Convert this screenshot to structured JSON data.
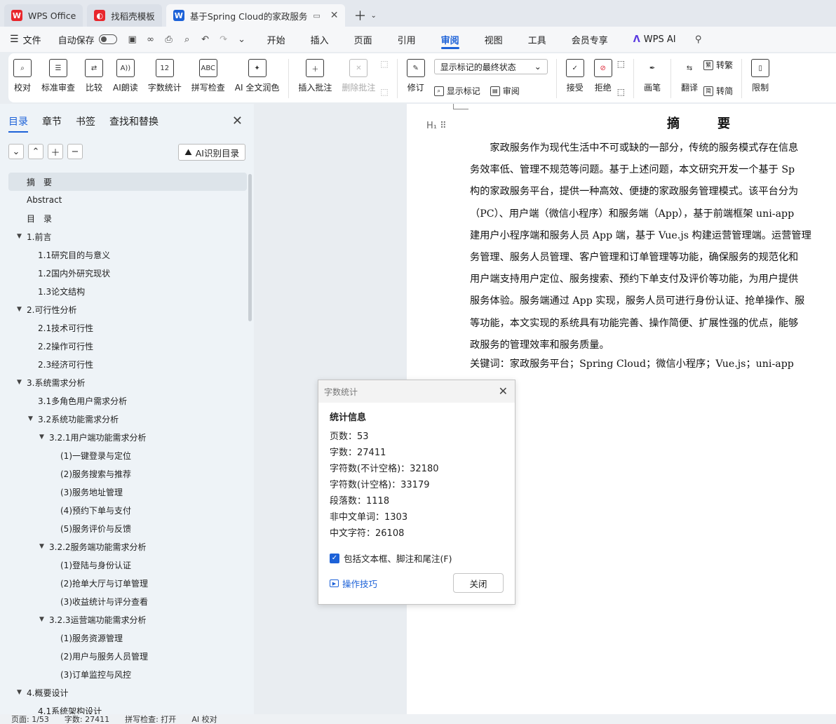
{
  "tabs": [
    {
      "label": "WPS Office",
      "logo_color": "#e8262c"
    },
    {
      "label": "找稻壳模板",
      "logo_color": "#e8262c"
    },
    {
      "label": "基于Spring Cloud的家政服务",
      "logo_color": "#1d62d8"
    }
  ],
  "menu": {
    "file": "文件",
    "autosave": "自动保存",
    "tabs": [
      "开始",
      "插入",
      "页面",
      "引用",
      "审阅",
      "视图",
      "工具",
      "会员专享"
    ],
    "active_tab": "审阅",
    "wps_ai": "WPS AI"
  },
  "ribbon": {
    "proof": "校对",
    "std_review": "标准审查",
    "compare": "比较",
    "ai_read": "AI朗读",
    "word_count": "字数统计",
    "spell": "拼写检查",
    "ai_polish": "AI 全文润色",
    "insert_comment": "插入批注",
    "delete_comment": "删除批注",
    "revise": "修订",
    "markup_select": "显示标记的最终状态",
    "show_markup": "显示标记",
    "review": "审阅",
    "accept": "接受",
    "reject": "拒绝",
    "pen": "画笔",
    "translate": "翻译",
    "to_trad": "转繁",
    "to_simp": "转简",
    "restrict": "限制"
  },
  "nav": {
    "tabs": [
      "目录",
      "章节",
      "书签",
      "查找和替换"
    ],
    "ai_toc": "AI识别目录",
    "items": [
      {
        "label": "摘　要",
        "level": 0,
        "arrow": false,
        "selected": true
      },
      {
        "label": "Abstract",
        "level": 0,
        "arrow": false
      },
      {
        "label": "目　录",
        "level": 0,
        "arrow": false
      },
      {
        "label": "1.前言",
        "level": 0,
        "arrow": true
      },
      {
        "label": "1.1研究目的与意义",
        "level": 1,
        "arrow": false
      },
      {
        "label": "1.2国内外研究现状",
        "level": 1,
        "arrow": false
      },
      {
        "label": "1.3论文结构",
        "level": 1,
        "arrow": false
      },
      {
        "label": "2.可行性分析",
        "level": 0,
        "arrow": true
      },
      {
        "label": "2.1技术可行性",
        "level": 1,
        "arrow": false
      },
      {
        "label": "2.2操作可行性",
        "level": 1,
        "arrow": false
      },
      {
        "label": "2.3经济可行性",
        "level": 1,
        "arrow": false
      },
      {
        "label": "3.系统需求分析",
        "level": 0,
        "arrow": true
      },
      {
        "label": "3.1多角色用户需求分析",
        "level": 1,
        "arrow": false
      },
      {
        "label": "3.2系统功能需求分析",
        "level": 1,
        "arrow": true
      },
      {
        "label": "3.2.1用户端功能需求分析",
        "level": 2,
        "arrow": true
      },
      {
        "label": "(1)一键登录与定位",
        "level": 3,
        "arrow": false
      },
      {
        "label": "(2)服务搜索与推荐",
        "level": 3,
        "arrow": false
      },
      {
        "label": "(3)服务地址管理",
        "level": 3,
        "arrow": false
      },
      {
        "label": "(4)预约下单与支付",
        "level": 3,
        "arrow": false
      },
      {
        "label": "(5)服务评价与反馈",
        "level": 3,
        "arrow": false
      },
      {
        "label": "3.2.2服务端功能需求分析",
        "level": 2,
        "arrow": true
      },
      {
        "label": "(1)登陆与身份认证",
        "level": 3,
        "arrow": false
      },
      {
        "label": "(2)抢单大厅与订单管理",
        "level": 3,
        "arrow": false
      },
      {
        "label": "(3)收益统计与评分查看",
        "level": 3,
        "arrow": false
      },
      {
        "label": "3.2.3运营端功能需求分析",
        "level": 2,
        "arrow": true
      },
      {
        "label": "(1)服务资源管理",
        "level": 3,
        "arrow": false
      },
      {
        "label": "(2)用户与服务人员管理",
        "level": 3,
        "arrow": false
      },
      {
        "label": "(3)订单监控与风控",
        "level": 3,
        "arrow": false
      },
      {
        "label": "4.概要设计",
        "level": 0,
        "arrow": true
      },
      {
        "label": "4.1系统架构设计",
        "level": 1,
        "arrow": false
      }
    ]
  },
  "doc": {
    "heading": "摘　要",
    "lines": [
      "家政服务作为现代生活中不可或缺的一部分，传统的服务模式存在信息",
      "务效率低、管理不规范等问题。基于上述问题，本文研究开发一个基于 Sp",
      "构的家政服务平台，提供一种高效、便捷的家政服务管理模式。该平台分为",
      "（PC）、用户端（微信小程序）和服务端（App），基于前端框架 uni-app",
      "建用户小程序端和服务人员 App 端，基于 Vue.js 构建运营管理端。运营管理",
      "务管理、服务人员管理、客户管理和订单管理等功能，确保服务的规范化和",
      "用户端支持用户定位、服务搜索、预约下单支付及评价等功能，为用户提供",
      "服务体验。服务端通过 App 实现，服务人员可进行身份认证、抢单操作、服",
      "等功能，本文实现的系统具有功能完善、操作简便、扩展性强的优点，能够",
      "政服务的管理效率和服务质量。"
    ],
    "keywords": "关键词：家政服务平台；Spring Cloud；微信小程序；Vue.js；uni-app"
  },
  "dialog": {
    "title": "字数统计",
    "section": "统计信息",
    "stats": [
      "页数：53",
      "字数：27411",
      "字符数(不计空格)：32180",
      "字符数(计空格)：33179",
      "段落数：1118",
      "非中文单词：1303",
      "中文字符：26108"
    ],
    "include_label": "包括文本框、脚注和尾注(F)",
    "tips": "操作技巧",
    "close": "关闭"
  },
  "status": {
    "page": "页面: 1/53",
    "words": "字数: 27411",
    "spell": "拼写检查: 打开",
    "ai_proof": "AI 校对"
  }
}
